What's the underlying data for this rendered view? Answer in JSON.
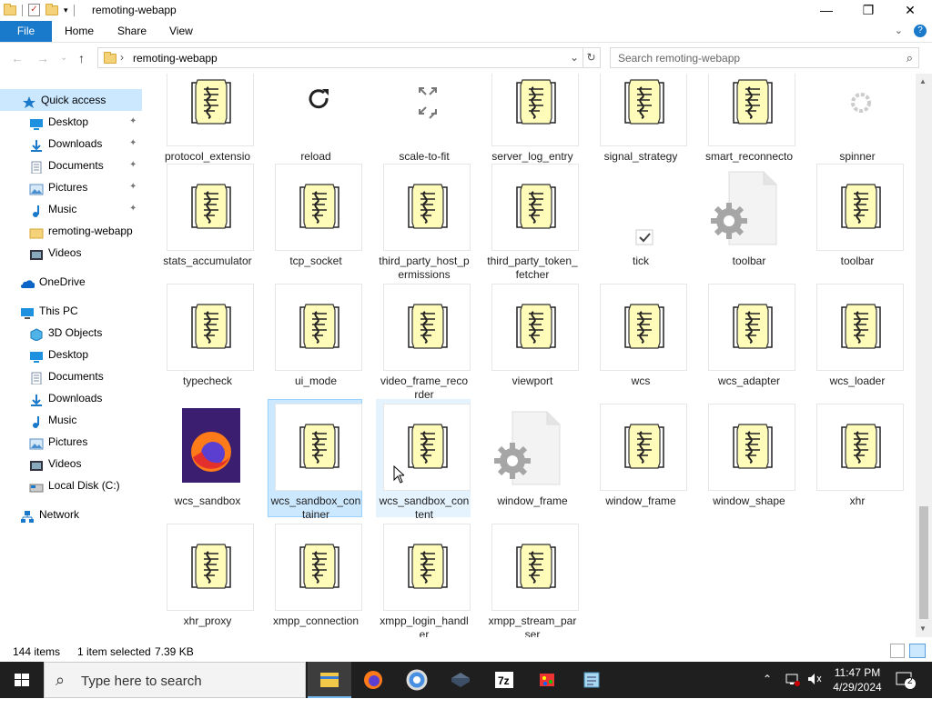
{
  "window": {
    "title": "remoting-webapp",
    "controls": {
      "minimize": "—",
      "maximize": "❐",
      "close": "✕"
    }
  },
  "ribbon": {
    "tabs": [
      "File",
      "Home",
      "Share",
      "View"
    ],
    "expand_glyph": "⌄",
    "help_glyph": "?"
  },
  "address": {
    "back": "←",
    "forward": "→",
    "history": "⌄",
    "up": "↑",
    "separator": "›",
    "path": "remoting-webapp",
    "dropdown": "⌄",
    "refresh": "↻",
    "search_placeholder": "Search remoting-webapp",
    "search_glyph": "⌕"
  },
  "nav": {
    "quick_access": {
      "label": "Quick access",
      "icon": "star-icon"
    },
    "quick_items": [
      {
        "label": "Desktop",
        "icon": "desktop-icon",
        "pinned": true
      },
      {
        "label": "Downloads",
        "icon": "downloads-icon",
        "pinned": true
      },
      {
        "label": "Documents",
        "icon": "documents-icon",
        "pinned": true
      },
      {
        "label": "Pictures",
        "icon": "pictures-icon",
        "pinned": true
      },
      {
        "label": "Music",
        "icon": "music-icon",
        "pinned": true
      },
      {
        "label": "remoting-webapp",
        "icon": "folder-icon",
        "pinned": false
      },
      {
        "label": "Videos",
        "icon": "videos-icon",
        "pinned": false
      }
    ],
    "onedrive": "OneDrive",
    "this_pc": "This PC",
    "pc_items": [
      {
        "label": "3D Objects",
        "icon": "3d-objects-icon"
      },
      {
        "label": "Desktop",
        "icon": "desktop-icon"
      },
      {
        "label": "Documents",
        "icon": "documents-icon"
      },
      {
        "label": "Downloads",
        "icon": "downloads-icon"
      },
      {
        "label": "Music",
        "icon": "music-icon"
      },
      {
        "label": "Pictures",
        "icon": "pictures-icon"
      },
      {
        "label": "Videos",
        "icon": "videos-icon"
      },
      {
        "label": "Local Disk (C:)",
        "icon": "local-disk-icon"
      }
    ],
    "network": "Network",
    "pin_glyph": "📌"
  },
  "files": [
    {
      "name": "protocol_extension_manager",
      "icon": "script-icon"
    },
    {
      "name": "reload",
      "icon": "reload-icon"
    },
    {
      "name": "scale-to-fit",
      "icon": "scale-to-fit-icon"
    },
    {
      "name": "server_log_entry",
      "icon": "script-icon"
    },
    {
      "name": "signal_strategy",
      "icon": "script-icon"
    },
    {
      "name": "smart_reconnector",
      "icon": "script-icon"
    },
    {
      "name": "spinner",
      "icon": "spinner-icon"
    },
    {
      "name": "stats_accumulator",
      "icon": "script-icon"
    },
    {
      "name": "tcp_socket",
      "icon": "script-icon"
    },
    {
      "name": "third_party_host_permissions",
      "icon": "script-icon"
    },
    {
      "name": "third_party_token_fetcher",
      "icon": "script-icon"
    },
    {
      "name": "tick",
      "icon": "tick-icon"
    },
    {
      "name": "toolbar",
      "icon": "settings-file-icon"
    },
    {
      "name": "toolbar",
      "icon": "script-icon"
    },
    {
      "name": "typecheck",
      "icon": "script-icon"
    },
    {
      "name": "ui_mode",
      "icon": "script-icon"
    },
    {
      "name": "video_frame_recorder",
      "icon": "script-icon"
    },
    {
      "name": "viewport",
      "icon": "script-icon"
    },
    {
      "name": "wcs",
      "icon": "script-icon"
    },
    {
      "name": "wcs_adapter",
      "icon": "script-icon"
    },
    {
      "name": "wcs_loader",
      "icon": "script-icon"
    },
    {
      "name": "wcs_sandbox",
      "icon": "firefox-html-icon"
    },
    {
      "name": "wcs_sandbox_container",
      "icon": "script-icon",
      "state": "selected"
    },
    {
      "name": "wcs_sandbox_content",
      "icon": "script-icon",
      "state": "hover"
    },
    {
      "name": "window_frame",
      "icon": "settings-file-icon"
    },
    {
      "name": "window_frame",
      "icon": "script-icon"
    },
    {
      "name": "window_shape",
      "icon": "script-icon"
    },
    {
      "name": "xhr",
      "icon": "script-icon"
    },
    {
      "name": "xhr_proxy",
      "icon": "script-icon"
    },
    {
      "name": "xmpp_connection",
      "icon": "script-icon"
    },
    {
      "name": "xmpp_login_handler",
      "icon": "script-icon"
    },
    {
      "name": "xmpp_stream_parser",
      "icon": "script-icon"
    }
  ],
  "status": {
    "count": "144 items",
    "selection": "1 item selected",
    "size": "7.39 KB"
  },
  "taskbar": {
    "search_placeholder": "Type here to search",
    "apps": [
      "file-explorer-icon",
      "firefox-icon",
      "chrome-icon",
      "virtualbox-icon",
      "7zip-icon",
      "paint-icon",
      "notepad-icon"
    ],
    "app_7zip_label": "7z",
    "time": "11:47 PM",
    "date": "4/29/2024",
    "notifications": "2",
    "tray_chevron": "⌃"
  },
  "colors": {
    "accent": "#1979ca",
    "selection": "#cce8ff",
    "taskbar": "#1f1f1f"
  }
}
